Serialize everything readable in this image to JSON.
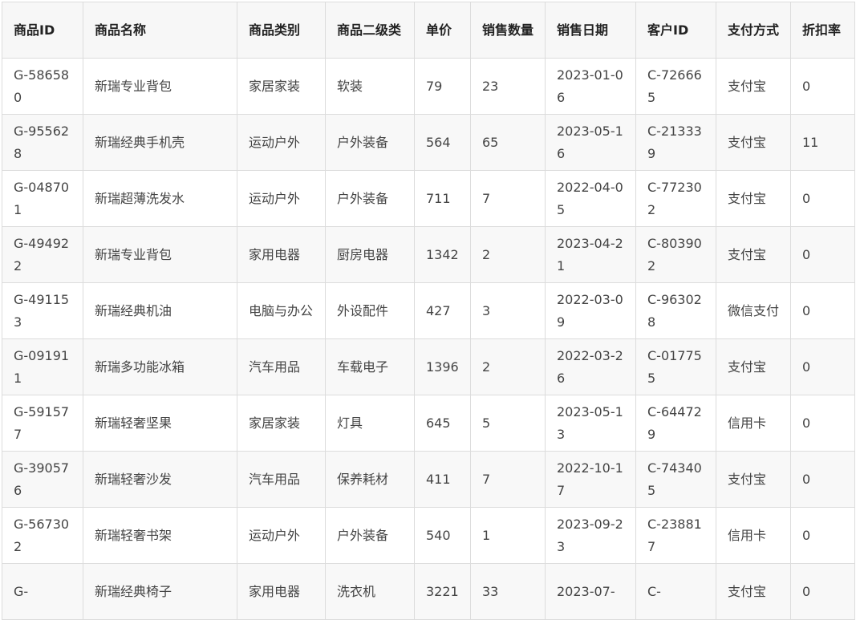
{
  "table": {
    "headers": [
      "商品ID",
      "商品名称",
      "商品类别",
      "商品二级类",
      "单价",
      "销售数量",
      "销售日期",
      "客户ID",
      "支付方式",
      "折扣率"
    ],
    "rows": [
      [
        "G-586580",
        "新瑞专业背包",
        "家居家装",
        "软装",
        "79",
        "23",
        "2023-01-06",
        "C-726665",
        "支付宝",
        "0"
      ],
      [
        "G-955628",
        "新瑞经典手机壳",
        "运动户外",
        "户外装备",
        "564",
        "65",
        "2023-05-16",
        "C-213339",
        "支付宝",
        "11"
      ],
      [
        "G-048701",
        "新瑞超薄洗发水",
        "运动户外",
        "户外装备",
        "711",
        "7",
        "2022-04-05",
        "C-772302",
        "支付宝",
        "0"
      ],
      [
        "G-494922",
        "新瑞专业背包",
        "家用电器",
        "厨房电器",
        "1342",
        "2",
        "2023-04-21",
        "C-803902",
        "支付宝",
        "0"
      ],
      [
        "G-491153",
        "新瑞经典机油",
        "电脑与办公",
        "外设配件",
        "427",
        "3",
        "2022-03-09",
        "C-963028",
        "微信支付",
        "0"
      ],
      [
        "G-091911",
        "新瑞多功能冰箱",
        "汽车用品",
        "车载电子",
        "1396",
        "2",
        "2022-03-26",
        "C-017755",
        "支付宝",
        "0"
      ],
      [
        "G-591577",
        "新瑞轻奢坚果",
        "家居家装",
        "灯具",
        "645",
        "5",
        "2023-05-13",
        "C-644729",
        "信用卡",
        "0"
      ],
      [
        "G-390576",
        "新瑞轻奢沙发",
        "汽车用品",
        "保养耗材",
        "411",
        "7",
        "2022-10-17",
        "C-743405",
        "支付宝",
        "0"
      ],
      [
        "G-567302",
        "新瑞轻奢书架",
        "运动户外",
        "户外装备",
        "540",
        "1",
        "2023-09-23",
        "C-238817",
        "信用卡",
        "0"
      ],
      [
        "G-",
        "新瑞经典椅子",
        "家用电器",
        "洗衣机",
        "3221",
        "33",
        "2023-07-",
        "C-",
        "支付宝",
        "0"
      ]
    ]
  }
}
